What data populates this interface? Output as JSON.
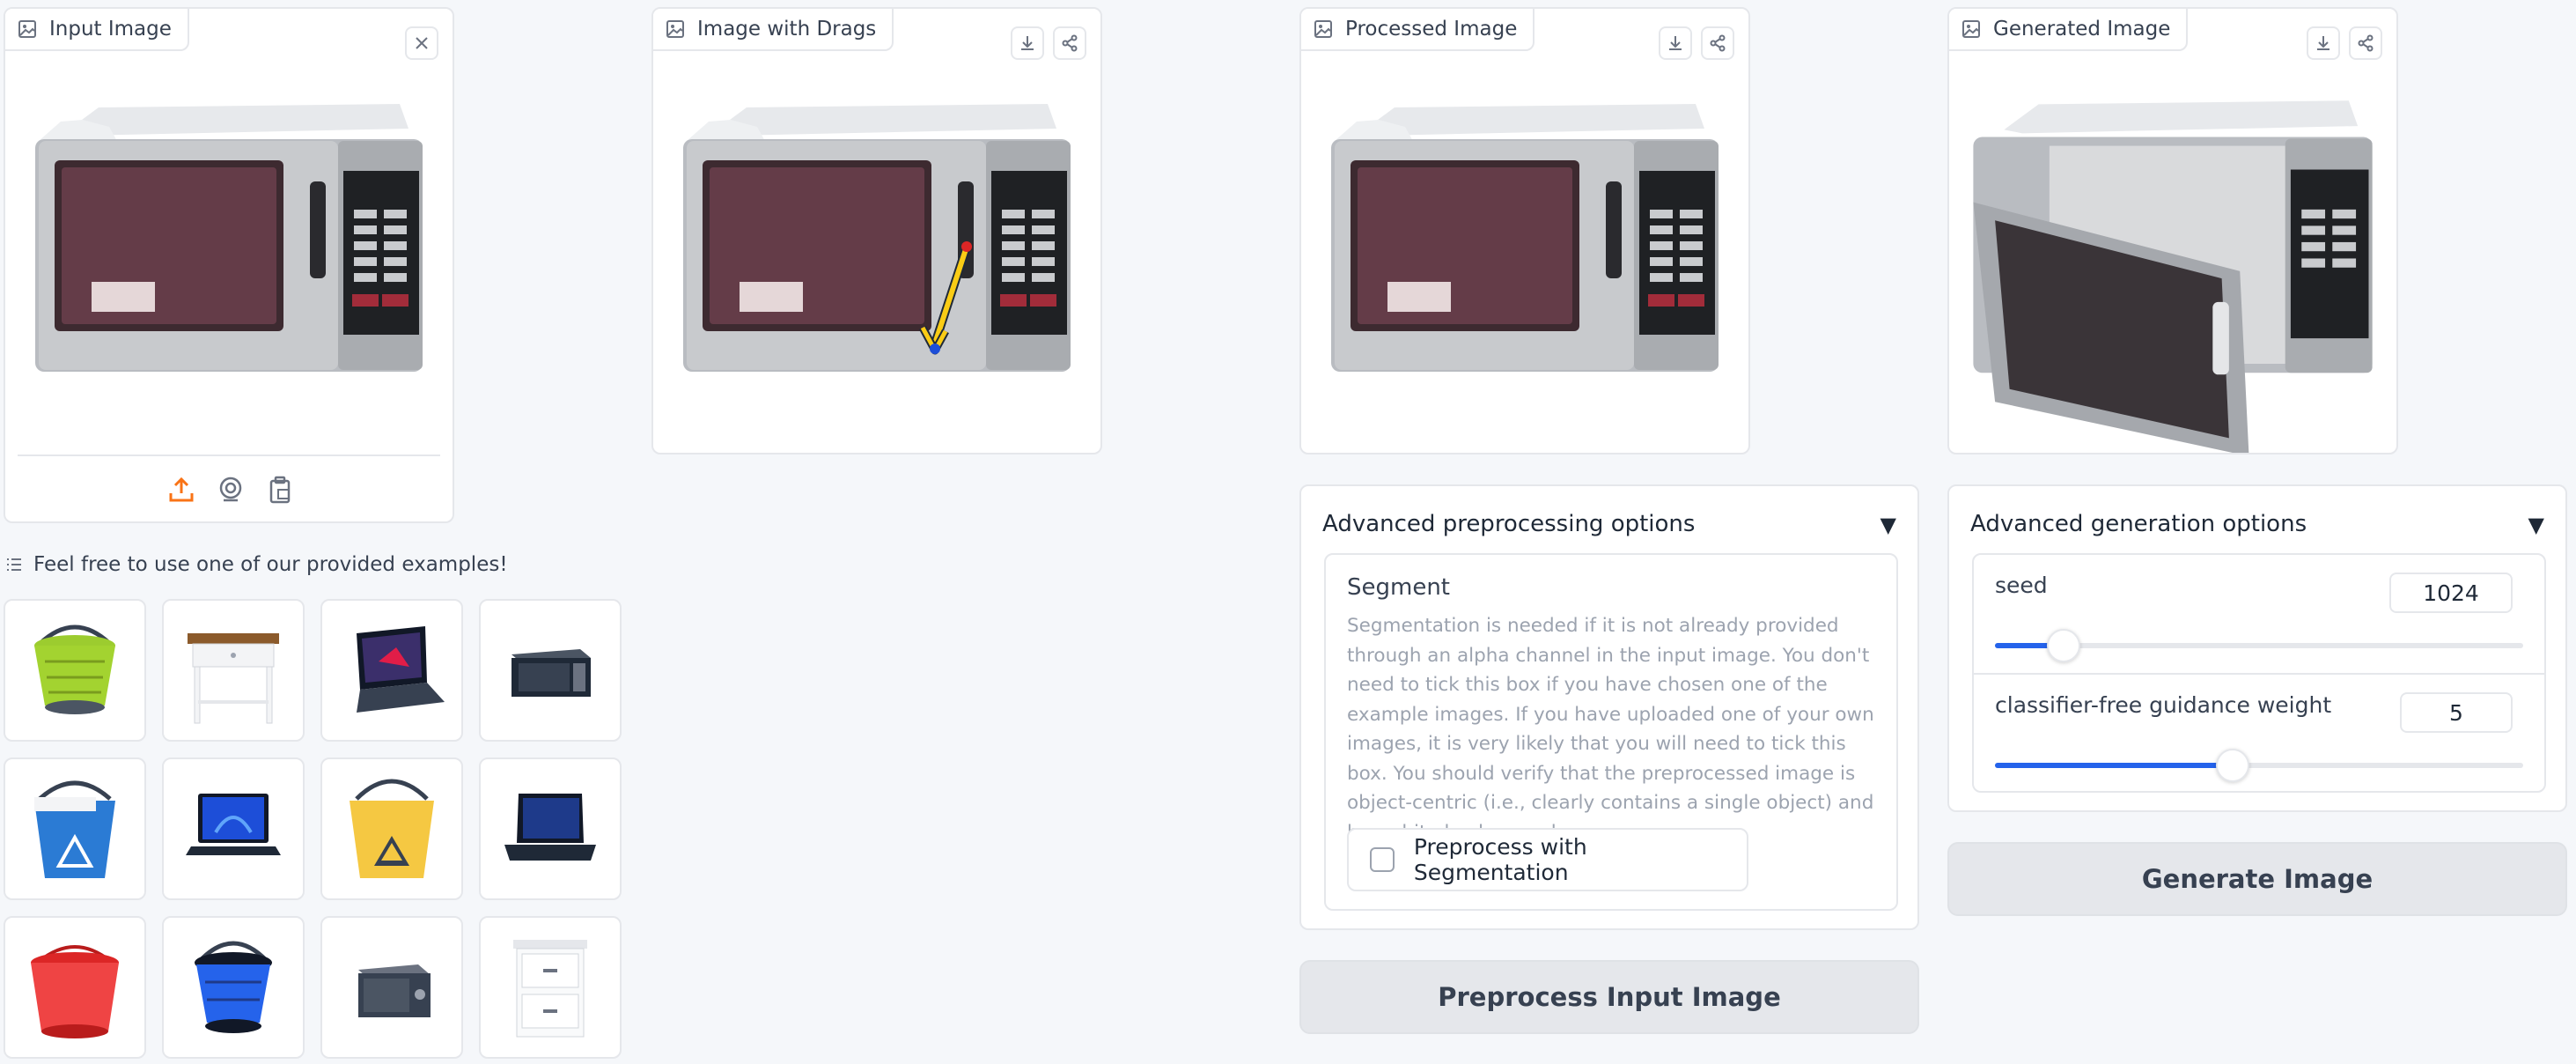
{
  "input_panel": {
    "label": "Input Image"
  },
  "drags_panel": {
    "label": "Image with Drags"
  },
  "processed_panel": {
    "label": "Processed Image"
  },
  "generated_panel": {
    "label": "Generated Image"
  },
  "examples": {
    "label": "Feel free to use one of our provided examples!",
    "items": [
      "green-collapsible-bucket",
      "white-side-table",
      "laptop-open",
      "black-microwave",
      "blue-mop-bucket",
      "laptop-dark",
      "yellow-mop-bucket",
      "laptop-black",
      "red-bucket",
      "blue-collapsible-bucket",
      "black-safe",
      "white-nightstand"
    ]
  },
  "preprocess": {
    "title": "Advanced preprocessing options",
    "segment_title": "Segment",
    "segment_info": "Segmentation is needed if it is not already provided through an alpha channel in the input image. You don't need to tick this box if you have chosen one of the example images. If you have uploaded one of your own images, it is very likely that you will need to tick this box. You should verify that the preprocessed image is object-centric (i.e., clearly contains a single object) and has white background.",
    "checkbox_label": "Preprocess with Segmentation",
    "checked": false,
    "button": "Preprocess Input Image"
  },
  "generation": {
    "title": "Advanced generation options",
    "seed_label": "seed",
    "seed_value": "1024",
    "seed_fraction": 0.13,
    "cfg_label": "classifier-free guidance weight",
    "cfg_value": "5",
    "cfg_fraction": 0.45,
    "button": "Generate Image"
  },
  "colors": {
    "accent": "#2563eb",
    "upload": "#f97316",
    "drag_arrow": "#facc15"
  }
}
